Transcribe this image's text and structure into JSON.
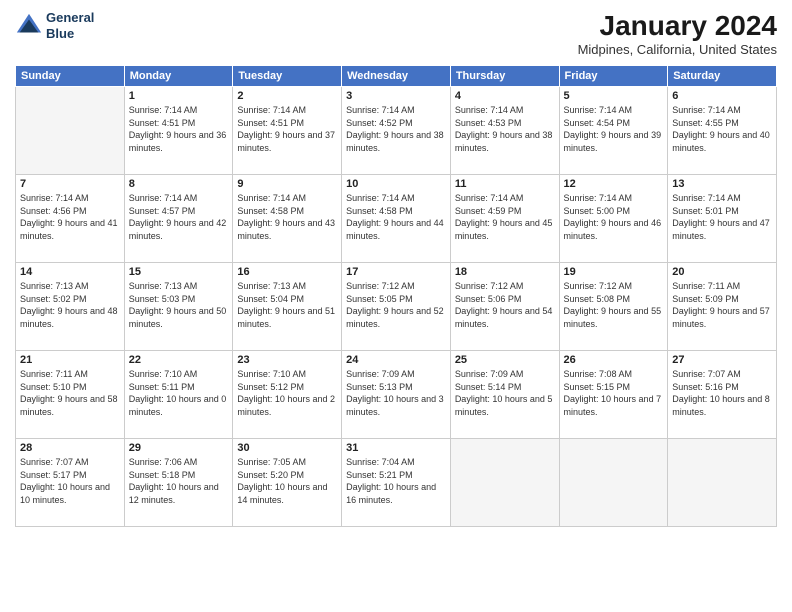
{
  "logo": {
    "line1": "General",
    "line2": "Blue"
  },
  "title": "January 2024",
  "location": "Midpines, California, United States",
  "header_days": [
    "Sunday",
    "Monday",
    "Tuesday",
    "Wednesday",
    "Thursday",
    "Friday",
    "Saturday"
  ],
  "weeks": [
    [
      {
        "day": "",
        "empty": true
      },
      {
        "day": "1",
        "sunrise": "Sunrise: 7:14 AM",
        "sunset": "Sunset: 4:51 PM",
        "daylight": "Daylight: 9 hours and 36 minutes."
      },
      {
        "day": "2",
        "sunrise": "Sunrise: 7:14 AM",
        "sunset": "Sunset: 4:51 PM",
        "daylight": "Daylight: 9 hours and 37 minutes."
      },
      {
        "day": "3",
        "sunrise": "Sunrise: 7:14 AM",
        "sunset": "Sunset: 4:52 PM",
        "daylight": "Daylight: 9 hours and 38 minutes."
      },
      {
        "day": "4",
        "sunrise": "Sunrise: 7:14 AM",
        "sunset": "Sunset: 4:53 PM",
        "daylight": "Daylight: 9 hours and 38 minutes."
      },
      {
        "day": "5",
        "sunrise": "Sunrise: 7:14 AM",
        "sunset": "Sunset: 4:54 PM",
        "daylight": "Daylight: 9 hours and 39 minutes."
      },
      {
        "day": "6",
        "sunrise": "Sunrise: 7:14 AM",
        "sunset": "Sunset: 4:55 PM",
        "daylight": "Daylight: 9 hours and 40 minutes."
      }
    ],
    [
      {
        "day": "7",
        "sunrise": "Sunrise: 7:14 AM",
        "sunset": "Sunset: 4:56 PM",
        "daylight": "Daylight: 9 hours and 41 minutes."
      },
      {
        "day": "8",
        "sunrise": "Sunrise: 7:14 AM",
        "sunset": "Sunset: 4:57 PM",
        "daylight": "Daylight: 9 hours and 42 minutes."
      },
      {
        "day": "9",
        "sunrise": "Sunrise: 7:14 AM",
        "sunset": "Sunset: 4:58 PM",
        "daylight": "Daylight: 9 hours and 43 minutes."
      },
      {
        "day": "10",
        "sunrise": "Sunrise: 7:14 AM",
        "sunset": "Sunset: 4:58 PM",
        "daylight": "Daylight: 9 hours and 44 minutes."
      },
      {
        "day": "11",
        "sunrise": "Sunrise: 7:14 AM",
        "sunset": "Sunset: 4:59 PM",
        "daylight": "Daylight: 9 hours and 45 minutes."
      },
      {
        "day": "12",
        "sunrise": "Sunrise: 7:14 AM",
        "sunset": "Sunset: 5:00 PM",
        "daylight": "Daylight: 9 hours and 46 minutes."
      },
      {
        "day": "13",
        "sunrise": "Sunrise: 7:14 AM",
        "sunset": "Sunset: 5:01 PM",
        "daylight": "Daylight: 9 hours and 47 minutes."
      }
    ],
    [
      {
        "day": "14",
        "sunrise": "Sunrise: 7:13 AM",
        "sunset": "Sunset: 5:02 PM",
        "daylight": "Daylight: 9 hours and 48 minutes."
      },
      {
        "day": "15",
        "sunrise": "Sunrise: 7:13 AM",
        "sunset": "Sunset: 5:03 PM",
        "daylight": "Daylight: 9 hours and 50 minutes."
      },
      {
        "day": "16",
        "sunrise": "Sunrise: 7:13 AM",
        "sunset": "Sunset: 5:04 PM",
        "daylight": "Daylight: 9 hours and 51 minutes."
      },
      {
        "day": "17",
        "sunrise": "Sunrise: 7:12 AM",
        "sunset": "Sunset: 5:05 PM",
        "daylight": "Daylight: 9 hours and 52 minutes."
      },
      {
        "day": "18",
        "sunrise": "Sunrise: 7:12 AM",
        "sunset": "Sunset: 5:06 PM",
        "daylight": "Daylight: 9 hours and 54 minutes."
      },
      {
        "day": "19",
        "sunrise": "Sunrise: 7:12 AM",
        "sunset": "Sunset: 5:08 PM",
        "daylight": "Daylight: 9 hours and 55 minutes."
      },
      {
        "day": "20",
        "sunrise": "Sunrise: 7:11 AM",
        "sunset": "Sunset: 5:09 PM",
        "daylight": "Daylight: 9 hours and 57 minutes."
      }
    ],
    [
      {
        "day": "21",
        "sunrise": "Sunrise: 7:11 AM",
        "sunset": "Sunset: 5:10 PM",
        "daylight": "Daylight: 9 hours and 58 minutes."
      },
      {
        "day": "22",
        "sunrise": "Sunrise: 7:10 AM",
        "sunset": "Sunset: 5:11 PM",
        "daylight": "Daylight: 10 hours and 0 minutes."
      },
      {
        "day": "23",
        "sunrise": "Sunrise: 7:10 AM",
        "sunset": "Sunset: 5:12 PM",
        "daylight": "Daylight: 10 hours and 2 minutes."
      },
      {
        "day": "24",
        "sunrise": "Sunrise: 7:09 AM",
        "sunset": "Sunset: 5:13 PM",
        "daylight": "Daylight: 10 hours and 3 minutes."
      },
      {
        "day": "25",
        "sunrise": "Sunrise: 7:09 AM",
        "sunset": "Sunset: 5:14 PM",
        "daylight": "Daylight: 10 hours and 5 minutes."
      },
      {
        "day": "26",
        "sunrise": "Sunrise: 7:08 AM",
        "sunset": "Sunset: 5:15 PM",
        "daylight": "Daylight: 10 hours and 7 minutes."
      },
      {
        "day": "27",
        "sunrise": "Sunrise: 7:07 AM",
        "sunset": "Sunset: 5:16 PM",
        "daylight": "Daylight: 10 hours and 8 minutes."
      }
    ],
    [
      {
        "day": "28",
        "sunrise": "Sunrise: 7:07 AM",
        "sunset": "Sunset: 5:17 PM",
        "daylight": "Daylight: 10 hours and 10 minutes."
      },
      {
        "day": "29",
        "sunrise": "Sunrise: 7:06 AM",
        "sunset": "Sunset: 5:18 PM",
        "daylight": "Daylight: 10 hours and 12 minutes."
      },
      {
        "day": "30",
        "sunrise": "Sunrise: 7:05 AM",
        "sunset": "Sunset: 5:20 PM",
        "daylight": "Daylight: 10 hours and 14 minutes."
      },
      {
        "day": "31",
        "sunrise": "Sunrise: 7:04 AM",
        "sunset": "Sunset: 5:21 PM",
        "daylight": "Daylight: 10 hours and 16 minutes."
      },
      {
        "day": "",
        "empty": true
      },
      {
        "day": "",
        "empty": true
      },
      {
        "day": "",
        "empty": true
      }
    ]
  ]
}
